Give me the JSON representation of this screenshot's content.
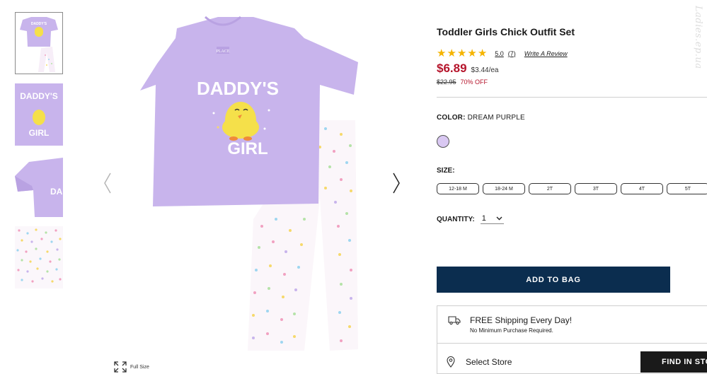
{
  "product": {
    "title": "Toddler Girls Chick Outfit Set",
    "rating": "5.0",
    "rating_count": "(7)",
    "stars": 5,
    "write_review": "Write A Review",
    "price": "$6.89",
    "per_each": "$3.44/ea",
    "original_price": "$22.95",
    "discount": "70% OFF"
  },
  "color": {
    "label": "COLOR:",
    "value": "DREAM PURPLE",
    "swatch_color": "#d9c8f2"
  },
  "size": {
    "label": "SIZE:",
    "options": [
      "12-18 M",
      "18-24 M",
      "2T",
      "3T",
      "4T",
      "5T"
    ]
  },
  "quantity": {
    "label": "QUANTITY:",
    "value": "1"
  },
  "add_to_bag": "ADD TO BAG",
  "shipping": {
    "title": "FREE Shipping Every Day!",
    "subtitle": "No Minimum Purchase Required."
  },
  "store": {
    "label": "Select Store",
    "find_button": "FIND IN STORE"
  },
  "gallery": {
    "fullsize_label": "Full Size",
    "shirt_text_top": "DADDY'S",
    "shirt_text_bottom": "GIRL",
    "brand_tag": "PLACE"
  },
  "watermark": "Ladies.ep.ua",
  "colors": {
    "accent_red": "#b5142b",
    "button_navy": "#0b2d4f",
    "shirt_purple": "#c8b4ec",
    "star_gold": "#f5b400"
  }
}
